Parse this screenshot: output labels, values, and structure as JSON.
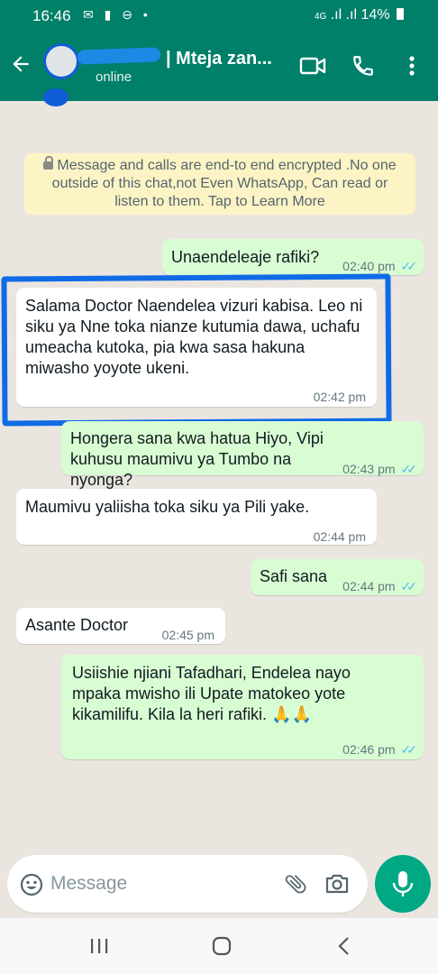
{
  "status_bar": {
    "time": "16:46",
    "network": "4G",
    "battery": "14%"
  },
  "header": {
    "contact_name": "| Mteja zan...",
    "contact_status": "online"
  },
  "encryption_notice": "Message and calls are end-to end encrypted .No one outside of this chat,not Even WhatsApp, Can read or listen to them. Tap to Learn More",
  "messages": [
    {
      "direction": "out",
      "text": "Unaendeleaje rafiki?",
      "time": "02:40 pm",
      "ticks": "read"
    },
    {
      "direction": "in",
      "text": "Salama Doctor Naendelea vizuri kabisa. Leo ni siku ya Nne toka nianze kutumia dawa, uchafu umeacha kutoka, pia kwa sasa hakuna miwasho yoyote ukeni.",
      "time": "02:42 pm"
    },
    {
      "direction": "out",
      "text": "Hongera sana kwa hatua Hiyo, Vipi kuhusu maumivu ya Tumbo na nyonga?",
      "time": "02:43 pm",
      "ticks": "read"
    },
    {
      "direction": "in",
      "text": "Maumivu yaliisha toka siku ya Pili yake.",
      "time": "02:44 pm"
    },
    {
      "direction": "out",
      "text": "Safi sana",
      "time": "02:44 pm",
      "ticks": "read"
    },
    {
      "direction": "in",
      "text": "Asante Doctor",
      "time": "02:45 pm"
    },
    {
      "direction": "out",
      "text": "Usiishie njiani Tafadhari, Endelea nayo mpaka mwisho ili Upate matokeo yote kikamilifu. Kila la heri rafiki. 🙏🙏",
      "time": "02:46 pm",
      "ticks": "read"
    }
  ],
  "composer": {
    "placeholder": "Message"
  },
  "colors": {
    "header": "#008069",
    "outgoing_bubble": "#d9fdd3",
    "incoming_bubble": "#ffffff",
    "chat_background": "#eae6df",
    "read_ticks": "#53bdeb",
    "mic_button": "#00a884",
    "highlight_annotation": "#0f6be6"
  },
  "icons": [
    "back-arrow-icon",
    "video-call-icon",
    "phone-icon",
    "more-vert-icon",
    "lock-icon",
    "emoji-icon",
    "attach-icon",
    "camera-icon",
    "mic-icon",
    "recents-icon",
    "home-icon",
    "back-nav-icon"
  ]
}
